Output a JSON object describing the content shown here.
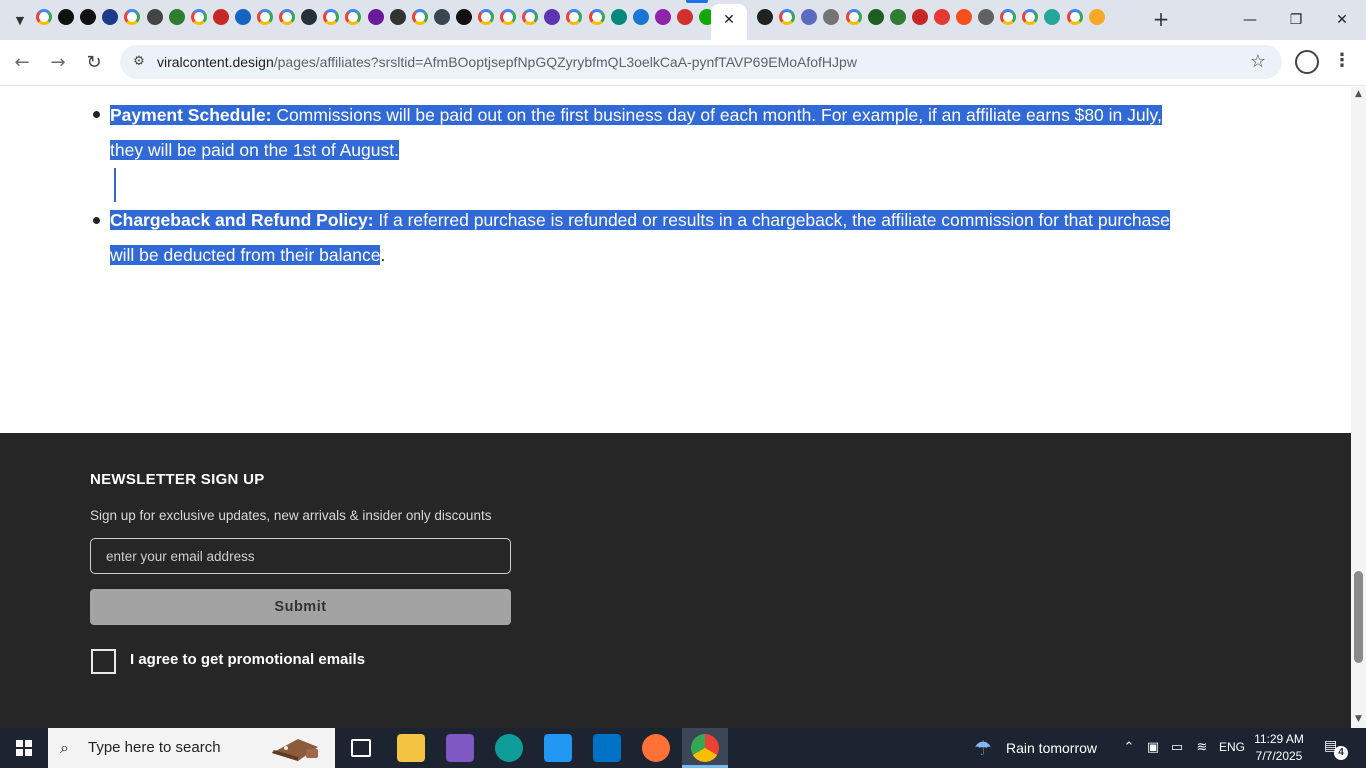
{
  "browser": {
    "tab_icons": [
      {
        "icon": "google-icon",
        "color": "#4285f4"
      },
      {
        "icon": "openai-icon",
        "color": "#111111"
      },
      {
        "icon": "openai-icon",
        "color": "#111111"
      },
      {
        "icon": "ttp-icon",
        "color": "#1e3a8a"
      },
      {
        "icon": "google-icon",
        "color": "#4285f4"
      },
      {
        "icon": "b-icon",
        "color": "#444444"
      },
      {
        "icon": "globe-green-icon",
        "color": "#2e7d32"
      },
      {
        "icon": "google-icon",
        "color": "#4285f4"
      },
      {
        "icon": "burger-icon",
        "color": "#c62828"
      },
      {
        "icon": "xf-icon",
        "color": "#1565c0"
      },
      {
        "icon": "google-icon",
        "color": "#4285f4"
      },
      {
        "icon": "google-icon",
        "color": "#4285f4"
      },
      {
        "icon": "graduation-cap-icon",
        "color": "#263238"
      },
      {
        "icon": "google-icon",
        "color": "#4285f4"
      },
      {
        "icon": "google-icon",
        "color": "#4285f4"
      },
      {
        "icon": "at-icon",
        "color": "#6a1b9a"
      },
      {
        "icon": "moon-icon",
        "color": "#333333"
      },
      {
        "icon": "google-icon",
        "color": "#4285f4"
      },
      {
        "icon": "windows-icon",
        "color": "#37474f"
      },
      {
        "icon": "wsj-icon",
        "color": "#111111"
      },
      {
        "icon": "google-icon",
        "color": "#4285f4"
      },
      {
        "icon": "google-icon",
        "color": "#4285f4"
      },
      {
        "icon": "google-icon",
        "color": "#4285f4"
      },
      {
        "icon": "circle-purple-icon",
        "color": "#5e35b1"
      },
      {
        "icon": "google-icon",
        "color": "#4285f4"
      },
      {
        "icon": "google-icon",
        "color": "#4285f4"
      },
      {
        "icon": "check-v-icon",
        "color": "#00897b"
      },
      {
        "icon": "logo-blue-icon",
        "color": "#1976d2"
      },
      {
        "icon": "cube-purple-icon",
        "color": "#8e24aa"
      },
      {
        "icon": "e-red-icon",
        "color": "#d32f2f"
      },
      {
        "icon": "upwork-icon",
        "color": "#14a800"
      },
      {
        "icon": "mobile-icon",
        "color": "#212121"
      },
      {
        "icon": "google-icon",
        "color": "#4285f4"
      },
      {
        "icon": "copilot-icon",
        "color": "#5c6bc0"
      },
      {
        "icon": "globe-gray-icon",
        "color": "#757575"
      },
      {
        "icon": "google-icon",
        "color": "#4285f4"
      },
      {
        "icon": "green-square-icon",
        "color": "#1b5e20"
      },
      {
        "icon": "chart-green-icon",
        "color": "#2e7d32"
      },
      {
        "icon": "flag-red-icon",
        "color": "#c62828"
      },
      {
        "icon": "opera-icon",
        "color": "#e53935"
      },
      {
        "icon": "stripes-icon",
        "color": "#f4511e"
      },
      {
        "icon": "globe-gray-icon",
        "color": "#616161"
      },
      {
        "icon": "google-icon",
        "color": "#4285f4"
      },
      {
        "icon": "google-icon",
        "color": "#4285f4"
      },
      {
        "icon": "pencil-icon",
        "color": "#26a69a"
      },
      {
        "icon": "google-icon",
        "color": "#4285f4"
      },
      {
        "icon": "info-yellow-icon",
        "color": "#f9a825"
      }
    ],
    "url_host": "viralcontent.design",
    "url_path": "/pages/affiliates?srsltid=AfmBOoptjsepfNpGQZyrybfmQL3oelkCaA-pynfTAVP69EMoAfofHJpw"
  },
  "content": {
    "items": [
      {
        "heading": "Payment Schedule:",
        "line1": " Commissions will be paid out on the first business day of each month. For example, if an affiliate earns $80 in July,",
        "line2": "they will be paid on the 1st of August."
      },
      {
        "heading": "Chargeback and Refund Policy:",
        "line1": " If a referred purchase is refunded or results in a chargeback, the affiliate commission for that purchase",
        "line2_selected": "will be deducted from their balance",
        "line2_tail": "."
      }
    ],
    "selection_color": "#3169d6"
  },
  "footer": {
    "title": "NEWSLETTER SIGN UP",
    "subtitle": "Sign up for exclusive updates, new arrivals & insider only discounts",
    "email_placeholder": "enter your email address",
    "submit_label": "Submit",
    "agree_label": "I agree to get promotional emails",
    "background": "#262626"
  },
  "taskbar": {
    "search_placeholder": "Type here to search",
    "apps": [
      {
        "icon": "task-view-icon",
        "color": "#ffffff"
      },
      {
        "icon": "file-explorer-icon",
        "color": "#f4c542"
      },
      {
        "icon": "copilot-icon",
        "color": "#7e57c2"
      },
      {
        "icon": "edge-icon",
        "color": "#0f9d9a"
      },
      {
        "icon": "microsoft-store-icon",
        "color": "#2196f3"
      },
      {
        "icon": "outlook-icon",
        "color": "#0072c6"
      },
      {
        "icon": "firefox-icon",
        "color": "#ff7139"
      },
      {
        "icon": "chrome-icon",
        "color": "#4caf50"
      }
    ],
    "weather": "Rain tomorrow",
    "language": "ENG",
    "time": "11:29 AM",
    "date": "7/7/2025",
    "notification_count": "4"
  }
}
